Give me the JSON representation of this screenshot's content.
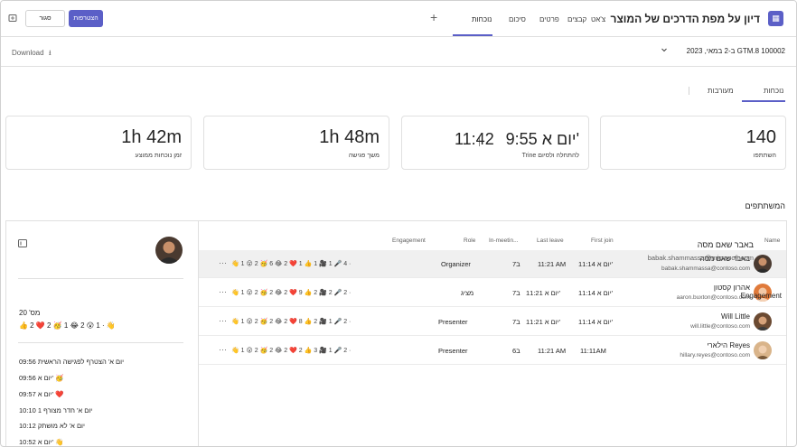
{
  "app": {
    "title": "דיון על מפת הדרכים של המוצר",
    "tabs": [
      {
        "label": "צ'אט"
      },
      {
        "label": "קבצים"
      },
      {
        "label": "פרטים"
      },
      {
        "label": "סיכום"
      },
      {
        "label": "נוכחות"
      }
    ],
    "add_tab": "+",
    "join_label": "הצטרפות",
    "close_label": "סגור"
  },
  "filter": {
    "session": "ב-2 במאי, 2023 GTM.8 100002",
    "download": "Download"
  },
  "subtabs": [
    {
      "label": "נוכחות"
    },
    {
      "label": "מעורבות"
    }
  ],
  "stats": [
    {
      "value": "140",
      "label": "השתתפו"
    },
    {
      "start": "9:55 יום א'",
      "end": "11:42",
      "label": "Trine להתחלה ולסיום"
    },
    {
      "value": "1h 48m",
      "label": "משך פגישה"
    },
    {
      "value": "1h 42m",
      "label": "זמן נוכחות ממוצע"
    }
  ],
  "participants_title": "המשתתפים",
  "table": {
    "headers": {
      "name": "Name",
      "first_join": "First join",
      "last_leave": "Last leave",
      "in_meeting": "In-meetin...",
      "role": "Role",
      "engagement": "Engagement"
    },
    "rows": [
      {
        "name": "באבר שאם מסה",
        "email": "babak.shammassa@contoso.com",
        "first_join": "11:14 יום א'",
        "last_leave": "11:21 AM",
        "duration": "7ב",
        "role": "Organizer",
        "engagement": "👋 1  😮 2  🥳 6  😂 2  ❤️ 1  👍 1  🎥 1  🎤 4  ·",
        "selected": true
      },
      {
        "name": "אהרון קסטון",
        "email": "aaron.buxton@contoso.com",
        "first_join": "11:14 יום א'",
        "last_leave": "11:21 יום א'",
        "duration": "7ב",
        "role": "מציג",
        "engagement": "👋 1  😮 2  🥳 2  😂 2  ❤️ 9  👍 2  🎥 2  🎤 2  ·",
        "selected": false
      },
      {
        "name": "Will Little",
        "email": "will.little@contoso.com",
        "first_join": "11:14 יום א'",
        "last_leave": "11:21 יום א'",
        "duration": "7ב",
        "role": "Presenter",
        "engagement": "👋 1  😮 2  🥳 2  😂 2  ❤️ 8  👍 2  🎥 1  🎤 2  ·",
        "selected": false
      },
      {
        "name": "הילארי Reyes",
        "email": "hillary.reyes@contoso.com",
        "first_join": "11:11AM",
        "last_leave": "11:21 AM",
        "duration": "6ב",
        "role": "Presenter",
        "engagement": "👋 1  😮 2  🥳 2  😂 2  ❤️ 2  👍 3  🎥 1  🎤 2  ·",
        "selected": false
      }
    ]
  },
  "side": {
    "name": "באבר שאם מסה",
    "email": "babak.shammassa@microsoft.com",
    "engagement_title": "Engagement",
    "count": "מס' 20",
    "reactions": "👍 2  ❤️ 2  🥳 1  😂 2  😮 1  ·  👋",
    "timeline": [
      {
        "text": "09:56 יום א' הצטרף לפגישה הראשית"
      },
      {
        "text": "09:56 יום א' 🥳"
      },
      {
        "text": "09:57 יום א' ❤️"
      },
      {
        "text": "10:10 יום א' חדר מצורף 1"
      },
      {
        "text": "10:12 יום א' לא מושתק"
      },
      {
        "text": "10:52 יום א' 👋"
      }
    ]
  }
}
